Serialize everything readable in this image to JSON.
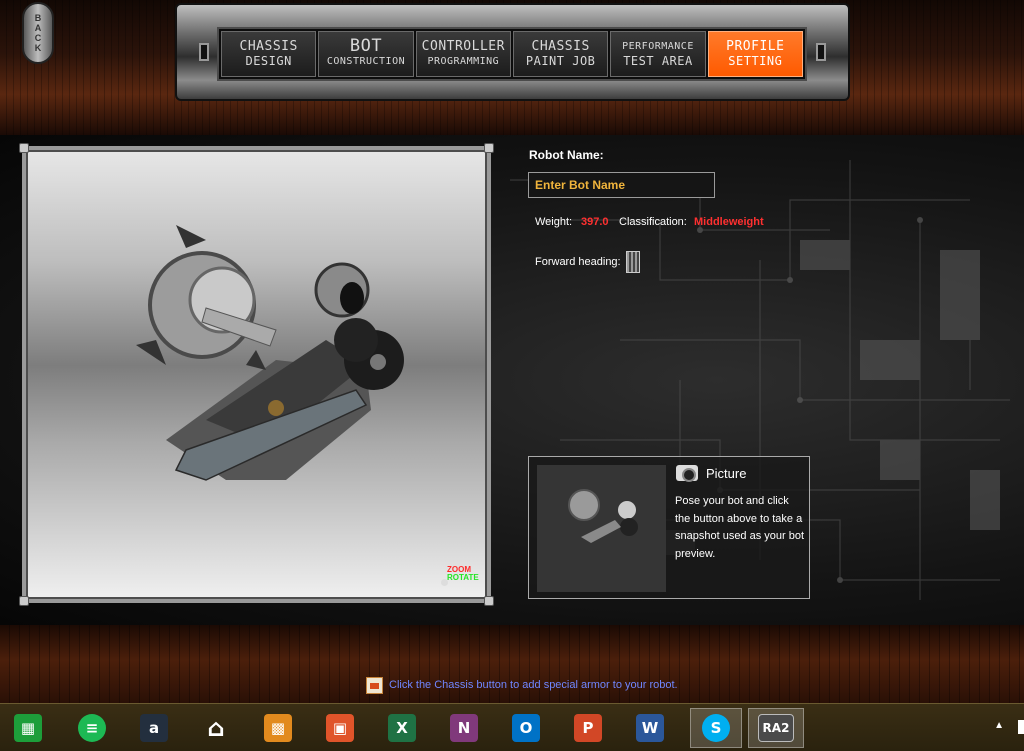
{
  "back_button": {
    "label": "BACK"
  },
  "nav": {
    "tabs": [
      {
        "line1": "CHASSIS",
        "line2": "DESIGN"
      },
      {
        "line1": "BOT",
        "line2": "CONSTRUCTION"
      },
      {
        "line1": "CONTROLLER",
        "line2": "PROGRAMMING"
      },
      {
        "line1": "CHASSIS",
        "line2": "PAINT JOB"
      },
      {
        "line1": "PERFORMANCE",
        "line2": "TEST AREA"
      },
      {
        "line1": "PROFILE",
        "line2": "SETTING"
      }
    ],
    "active_index": 5
  },
  "preview": {
    "zoom_label": "ZOOM",
    "rotate_label": "ROTATE"
  },
  "profile": {
    "name_label": "Robot Name:",
    "name_placeholder": "Enter Bot Name",
    "weight_label": "Weight:",
    "weight_value": "397.0",
    "classification_label": "Classification:",
    "classification_value": "Middleweight",
    "forward_heading_label": "Forward heading:"
  },
  "picture": {
    "title": "Picture",
    "description": "Pose your bot and click the button above to take a snapshot used as your bot preview."
  },
  "tip": {
    "text": "Click the Chassis button to add special armor to your robot."
  },
  "taskbar": {
    "items": [
      {
        "name": "store",
        "glyph": "",
        "color": "#1d9e3a"
      },
      {
        "name": "spotify",
        "glyph": "",
        "color": "#1db954"
      },
      {
        "name": "amazon",
        "glyph": "a",
        "color": "#232f3e"
      },
      {
        "name": "home",
        "glyph": "",
        "color": "transparent"
      },
      {
        "name": "files",
        "glyph": "",
        "color": "#e28a1e"
      },
      {
        "name": "photos",
        "glyph": "",
        "color": "#e0542a"
      },
      {
        "name": "excel",
        "glyph": "X",
        "color": "#1f7244"
      },
      {
        "name": "onenote",
        "glyph": "N",
        "color": "#80397b"
      },
      {
        "name": "outlook",
        "glyph": "O",
        "color": "#0072c6"
      },
      {
        "name": "powerpoint",
        "glyph": "P",
        "color": "#d24726"
      },
      {
        "name": "word",
        "glyph": "W",
        "color": "#2b579a"
      },
      {
        "name": "skype",
        "glyph": "S",
        "color": "#00aff0"
      },
      {
        "name": "ra2",
        "glyph": "RA2",
        "color": "#4a4a4a"
      }
    ],
    "active_index": 12
  }
}
